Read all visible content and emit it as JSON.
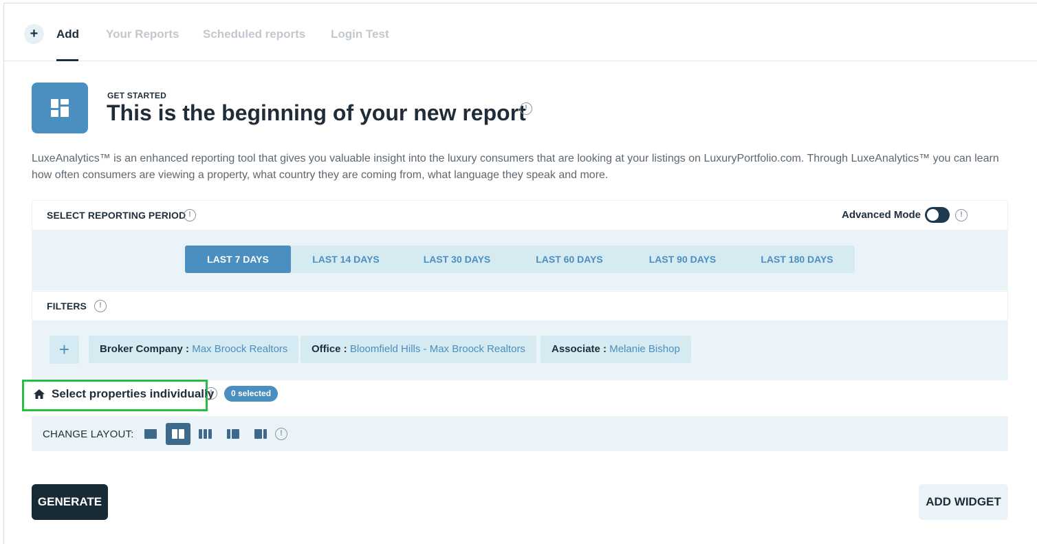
{
  "tabs": {
    "add_icon": "plus-icon",
    "items": [
      {
        "label": "Add"
      },
      {
        "label": "Your Reports"
      },
      {
        "label": "Scheduled reports"
      },
      {
        "label": "Login Test"
      }
    ]
  },
  "header": {
    "kicker": "GET STARTED",
    "title": "This is the beginning of your new report",
    "tile_icon": "layout-grid-icon"
  },
  "description": "LuxeAnalytics™ is an enhanced reporting tool that gives you valuable insight into the luxury consumers that are looking at your listings on LuxuryPortfolio.com. Through LuxeAnalytics™ you can learn how often consumers are viewing a property, what country they are coming from, what language they speak and more.",
  "reporting_period": {
    "label": "SELECT REPORTING PERIOD",
    "advanced_mode_label": "Advanced Mode",
    "advanced_mode_on": false,
    "periods": [
      "LAST 7 DAYS",
      "LAST 14 DAYS",
      "LAST 30 DAYS",
      "LAST 60 DAYS",
      "LAST 90 DAYS",
      "LAST 180 DAYS"
    ],
    "selected": "LAST 7 DAYS"
  },
  "filters": {
    "label": "FILTERS",
    "add_label": "+",
    "chips": [
      {
        "key": "Broker Company :",
        "value": "Max Broock Realtors"
      },
      {
        "key": "Office :",
        "value": "Bloomfield Hills - Max Broock Realtors"
      },
      {
        "key": "Associate :",
        "value": "Melanie Bishop"
      }
    ]
  },
  "properties": {
    "label": "Select properties individually",
    "badge": "0 selected"
  },
  "layout": {
    "label": "CHANGE LAYOUT:",
    "options": [
      "one-column-icon",
      "two-column-icon",
      "three-column-icon",
      "narrow-wide-icon",
      "wide-narrow-icon"
    ],
    "selected": "two-column-icon"
  },
  "actions": {
    "generate": "GENERATE",
    "add_widget": "ADD WIDGET"
  },
  "colors": {
    "accent": "#4a8fbf",
    "dark": "#172a36",
    "highlight_box": "#23c041"
  }
}
